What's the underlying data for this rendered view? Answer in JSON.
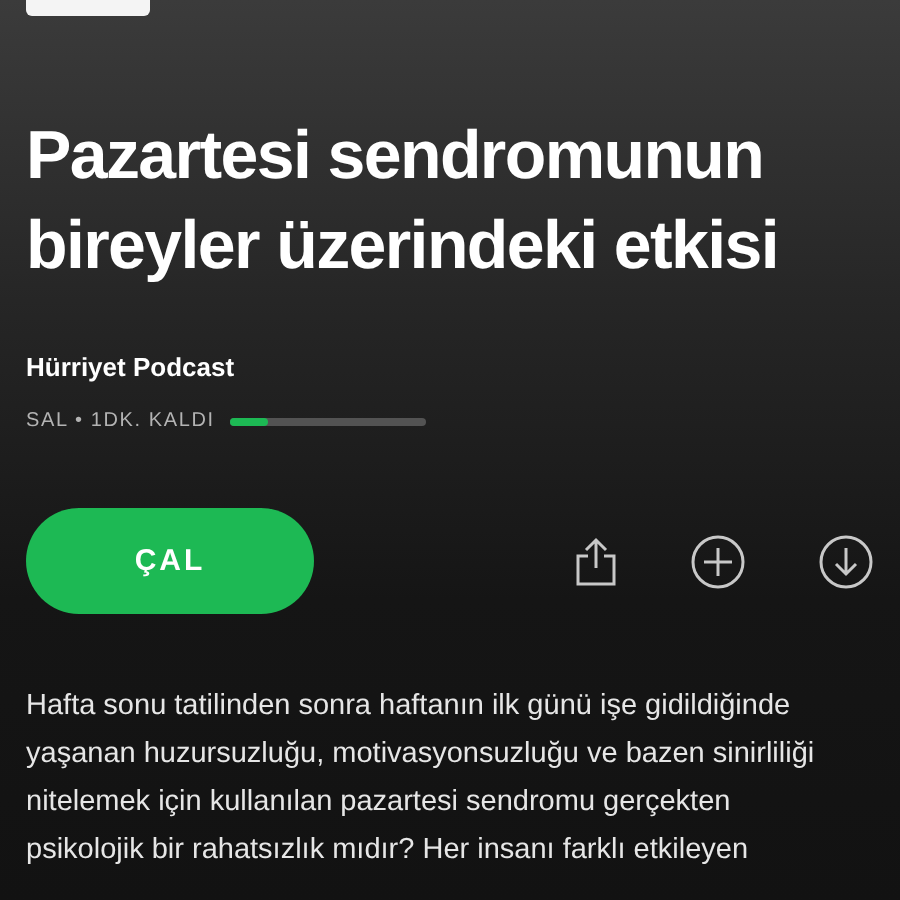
{
  "title_lines": [
    "Pazartesi sendromunun",
    "bireyler üzerindeki etkisi"
  ],
  "podcast": "Hürriyet Podcast",
  "meta": "SAL • 1DK. KALDI",
  "progress": {
    "level": 0.19
  },
  "play_button": "ÇAL",
  "description_lines": [
    "Hafta sonu tatilinden sonra haftanın ilk günü işe gidildiğinde",
    "yaşanan huzursuzluğu, motivasyonsuzluğu ve bazen sinirliliği",
    "nitelemek için kullanılan pazartesi sendromu gerçekten",
    "psikolojik bir rahatsızlık mıdır? Her insanı farklı etkileyen"
  ]
}
